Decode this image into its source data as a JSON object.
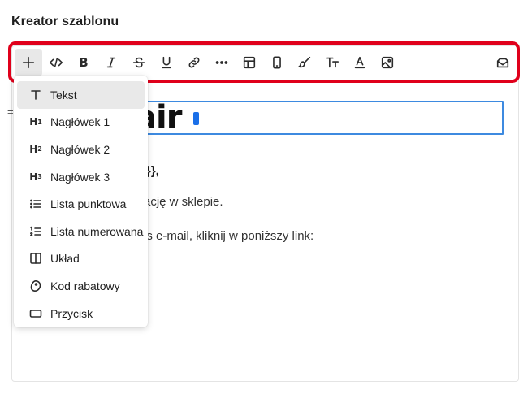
{
  "page": {
    "title": "Kreator szablonu"
  },
  "toolbar": {
    "buttons": [
      {
        "name": "add-block",
        "icon": "plus-icon",
        "active": true
      },
      {
        "name": "code",
        "icon": "code-icon"
      },
      {
        "name": "bold",
        "icon": "bold-icon",
        "glyph": "B"
      },
      {
        "name": "italic",
        "icon": "italic-icon"
      },
      {
        "name": "strikethrough",
        "icon": "strikethrough-icon"
      },
      {
        "name": "underline",
        "icon": "underline-icon"
      },
      {
        "name": "link",
        "icon": "link-icon"
      },
      {
        "name": "more",
        "icon": "more-icon"
      },
      {
        "name": "table",
        "icon": "table-icon"
      },
      {
        "name": "mobile-preview",
        "icon": "mobile-icon"
      },
      {
        "name": "style",
        "icon": "brush-icon"
      },
      {
        "name": "font-size",
        "icon": "font-size-icon"
      },
      {
        "name": "text-color",
        "icon": "text-color-icon"
      },
      {
        "name": "image",
        "icon": "image-icon"
      },
      {
        "name": "send-test",
        "icon": "mail-icon"
      }
    ]
  },
  "editor": {
    "logo_text": "air",
    "handle": "=",
    "lines": [
      "}},",
      "rację w sklepie.",
      "es e-mail, kliknij w poniższy link:"
    ]
  },
  "block_menu": {
    "items": [
      {
        "label": "Tekst",
        "icon": "text-icon",
        "selected": true
      },
      {
        "label": "Nagłówek 1",
        "icon": "heading-1-icon"
      },
      {
        "label": "Nagłówek 2",
        "icon": "heading-2-icon"
      },
      {
        "label": "Nagłówek 3",
        "icon": "heading-3-icon"
      },
      {
        "label": "Lista punktowa",
        "icon": "bullet-list-icon"
      },
      {
        "label": "Lista numerowana",
        "icon": "numbered-list-icon"
      },
      {
        "label": "Układ",
        "icon": "layout-icon"
      },
      {
        "label": "Kod rabatowy",
        "icon": "tag-icon"
      },
      {
        "label": "Przycisk",
        "icon": "button-icon"
      }
    ]
  },
  "colors": {
    "highlight": "#e0001b",
    "focus": "#3d8ae0",
    "cursor": "#1a6fe8"
  }
}
